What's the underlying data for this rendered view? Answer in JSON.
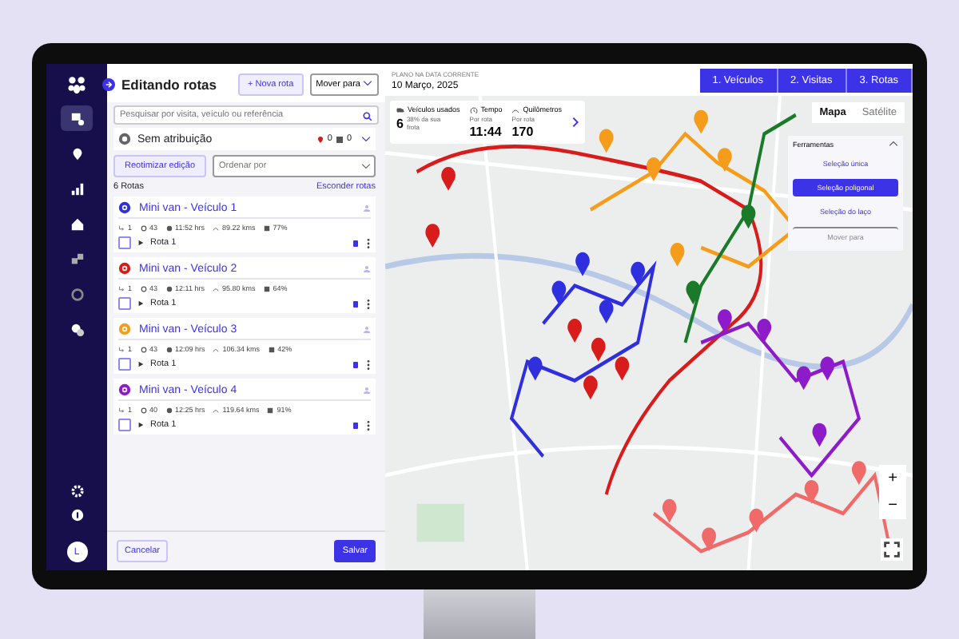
{
  "sidebar": {
    "nav": [
      {
        "selected": true
      },
      {
        "selected": false
      },
      {
        "selected": false
      },
      {
        "selected": false
      },
      {
        "selected": false
      },
      {
        "selected": false
      },
      {
        "selected": false
      }
    ],
    "avatar": "L"
  },
  "panel": {
    "title": "Editando rotas",
    "new_route": "+ Nova rota",
    "move_to": "Mover para",
    "search": {
      "placeholder": "Pesquisar por visita, veículo ou referência"
    },
    "unassigned": {
      "label": "Sem atribuição",
      "pins": "0",
      "boxes": "0"
    },
    "reoptimize": "Reotimizar edição",
    "sort": {
      "placeholder": "Ordenar por"
    },
    "count": "6 Rotas",
    "hide": "Esconder rotas",
    "vehicles": [
      {
        "name": "Mini van - Veículo 1",
        "color": "#2f2fe0",
        "routes": "1",
        "visits": "43",
        "time": "11:52 hrs",
        "distance": "89.22 kms",
        "capacity": "77%",
        "route": "Rota 1",
        "checked": false
      },
      {
        "name": "Mini van - Veículo 2",
        "color": "#d81b1b",
        "routes": "1",
        "visits": "43",
        "time": "12:11 hrs",
        "distance": "95.80 kms",
        "capacity": "64%",
        "route": "Rota 1",
        "checked": false
      },
      {
        "name": "Mini van - Veículo 3",
        "color": "#f59c1a",
        "routes": "1",
        "visits": "43",
        "time": "12:09 hrs",
        "distance": "106.34 kms",
        "capacity": "42%",
        "route": "Rota 1",
        "checked": false
      },
      {
        "name": "Mini van - Veículo 4",
        "color": "#8e1bc9",
        "routes": "1",
        "visits": "40",
        "time": "12:25 hrs",
        "distance": "119.64 kms",
        "capacity": "91%",
        "route": "Rota 1",
        "checked": false
      }
    ],
    "cancel": "Cancelar",
    "save": "Salvar"
  },
  "map": {
    "plan_label": "PLANO NA DATA CORRENTE",
    "plan_date": "10 Março, 2025",
    "steps": [
      "1. Veículos",
      "2. Visitas",
      "3. Rotas"
    ],
    "stats": [
      {
        "kind": "vehicles",
        "label": "Veículos usados",
        "value": "6",
        "note": "38% da sua frota"
      },
      {
        "kind": "time",
        "label": "Tempo",
        "sub": "Por rota",
        "value": "11:44"
      },
      {
        "kind": "distance",
        "label": "Quilômetros",
        "sub": "Por rota",
        "value": "170"
      }
    ],
    "views": [
      {
        "label": "Mapa",
        "selected": true
      },
      {
        "label": "Satélite",
        "selected": false
      }
    ],
    "tools": {
      "title": "Ferramentas",
      "items": [
        {
          "label": "Seleção única",
          "selected": false,
          "disabled": false
        },
        {
          "label": "Seleção poligonal",
          "selected": true,
          "disabled": false
        },
        {
          "label": "Seleção do laço",
          "selected": false,
          "disabled": false
        },
        {
          "label": "Mover para",
          "selected": false,
          "disabled": true
        }
      ]
    },
    "zoom_in": "+",
    "zoom_out": "−"
  }
}
